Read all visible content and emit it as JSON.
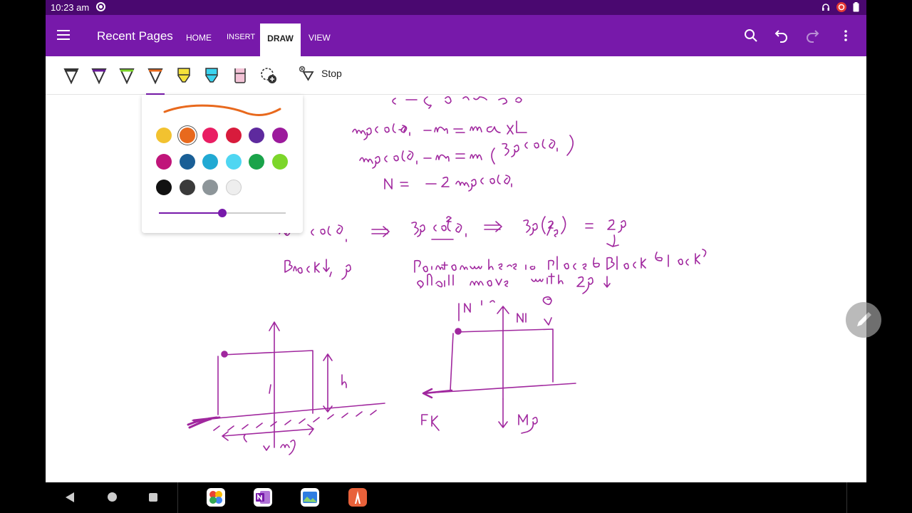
{
  "status": {
    "time": "10:23 am"
  },
  "appbar": {
    "title": "Recent Pages",
    "tabs": [
      "HOME",
      "INSERT",
      "DRAW",
      "VIEW"
    ],
    "active_tab": "DRAW"
  },
  "toolbar": {
    "stop_label": "Stop",
    "pens": [
      {
        "name": "pen-black",
        "color": "#333333"
      },
      {
        "name": "pen-purple",
        "color": "#6a1b9a"
      },
      {
        "name": "pen-green",
        "color": "#7cd62a"
      },
      {
        "name": "pen-orange",
        "color": "#e8691d"
      },
      {
        "name": "highlighter-yellow",
        "color": "#f4e23a"
      },
      {
        "name": "highlighter-cyan",
        "color": "#3ad3ef"
      },
      {
        "name": "highlighter-pink",
        "color": "#f3c3d6"
      }
    ]
  },
  "palette": {
    "colors": [
      "#f2c230",
      "#e8691d",
      "#e91e63",
      "#d81b3c",
      "#5e2a9e",
      "#9c1a9c",
      "#c0157a",
      "#1a5f96",
      "#21a9d3",
      "#4fd6f2",
      "#1aa34a",
      "#7cd62a",
      "#111111",
      "#3a3a3a",
      "#8d9599",
      "#eeeeee"
    ],
    "selected_color": "#e8691d",
    "thickness_fraction": 0.5
  },
  "ink_color": "#a0279e"
}
